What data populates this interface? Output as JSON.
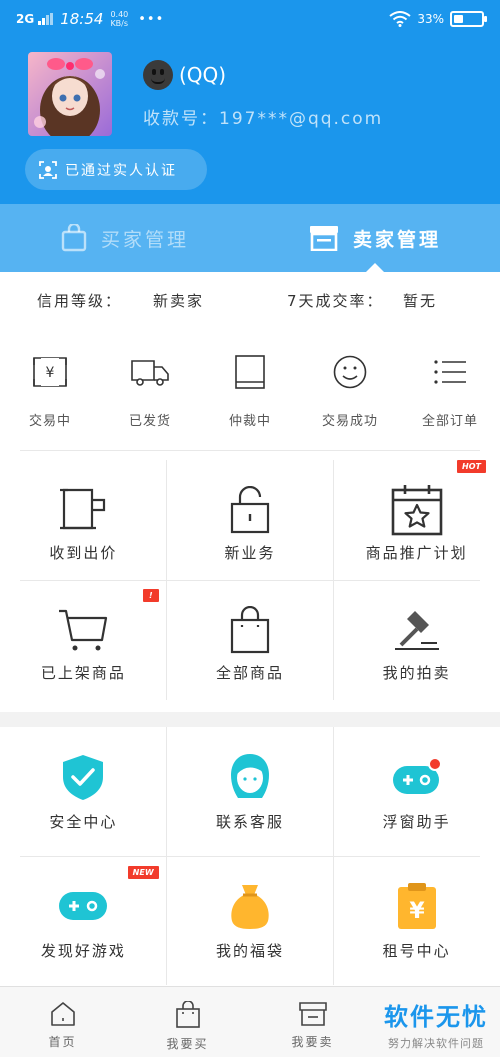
{
  "status_bar": {
    "signal": "2G",
    "time": "18:54",
    "speed_value": "0.40",
    "speed_unit": "KB/s",
    "more": "•••",
    "battery_percent": "33%",
    "battery_level": 0.33
  },
  "profile": {
    "nickname": "(QQ)",
    "account": "收款号：197***@qq.com",
    "verified_label": "已通过实人认证"
  },
  "tabs": [
    {
      "label": "买家管理",
      "active": false
    },
    {
      "label": "卖家管理",
      "active": true
    }
  ],
  "seller": {
    "credit_label": "信用等级：",
    "credit_value": "新卖家",
    "rate_label": "7天成交率：",
    "rate_value": "暂无",
    "orders": [
      {
        "label": "交易中",
        "icon": "yen-receipt-icon"
      },
      {
        "label": "已发货",
        "icon": "truck-icon"
      },
      {
        "label": "仲裁中",
        "icon": "book-icon"
      },
      {
        "label": "交易成功",
        "icon": "smile-icon"
      },
      {
        "label": "全部订单",
        "icon": "list-icon"
      }
    ],
    "tools": [
      {
        "label": "收到出价",
        "icon": "mug-icon",
        "badge": ""
      },
      {
        "label": "新业务",
        "icon": "lock-icon",
        "badge": ""
      },
      {
        "label": "商品推广计划",
        "icon": "calendar-star-icon",
        "badge": "HOT"
      },
      {
        "label": "已上架商品",
        "icon": "cart-icon",
        "badge": "!"
      },
      {
        "label": "全部商品",
        "icon": "bag-icon",
        "badge": ""
      },
      {
        "label": "我的拍卖",
        "icon": "gavel-icon",
        "badge": ""
      }
    ]
  },
  "services": [
    {
      "label": "安全中心",
      "icon": "shield-check-icon",
      "badge": ""
    },
    {
      "label": "联系客服",
      "icon": "support-agent-icon",
      "badge": ""
    },
    {
      "label": "浮窗助手",
      "icon": "gamepad-dot-icon",
      "badge": ""
    },
    {
      "label": "发现好游戏",
      "icon": "gamepad-icon",
      "badge": "NEW"
    },
    {
      "label": "我的福袋",
      "icon": "lucky-bag-icon",
      "badge": ""
    },
    {
      "label": "租号中心",
      "icon": "rent-clipboard-icon",
      "badge": ""
    }
  ],
  "bottom_nav": [
    {
      "label": "首页",
      "icon": "home-icon"
    },
    {
      "label": "我要买",
      "icon": "bag-icon"
    },
    {
      "label": "我要卖",
      "icon": "store-icon"
    }
  ],
  "watermark": {
    "title": "软件无忧",
    "subtitle": "努力解决软件问题"
  },
  "colors": {
    "primary": "#1b96ec",
    "tab_bar": "#56b3f2",
    "teal": "#1fc4d4",
    "orange": "#ffb62e",
    "badge_red": "#f23b2b"
  }
}
